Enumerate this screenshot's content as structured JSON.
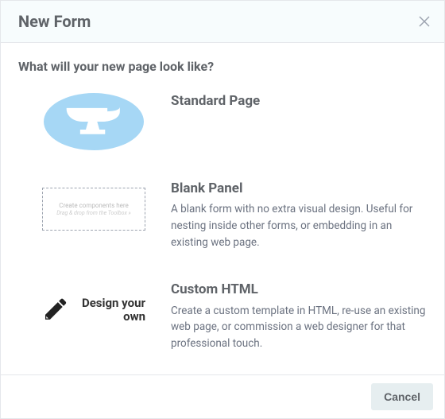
{
  "header": {
    "title": "New Form"
  },
  "prompt": "What will your new page look like?",
  "options": [
    {
      "title": "Standard Page",
      "desc": ""
    },
    {
      "title": "Blank Panel",
      "desc": "A blank form with no extra visual design. Useful for nesting inside other forms, or embedding in an existing web page.",
      "thumb_line1": "Create components here",
      "thumb_line2": "Drag & drop from the Toolbox »"
    },
    {
      "title": "Custom HTML",
      "desc": "Create a custom template in HTML, re-use an existing web page, or commission a web designer for that professional touch.",
      "thumb_label": "Design your own"
    }
  ],
  "footer": {
    "cancel_label": "Cancel"
  }
}
